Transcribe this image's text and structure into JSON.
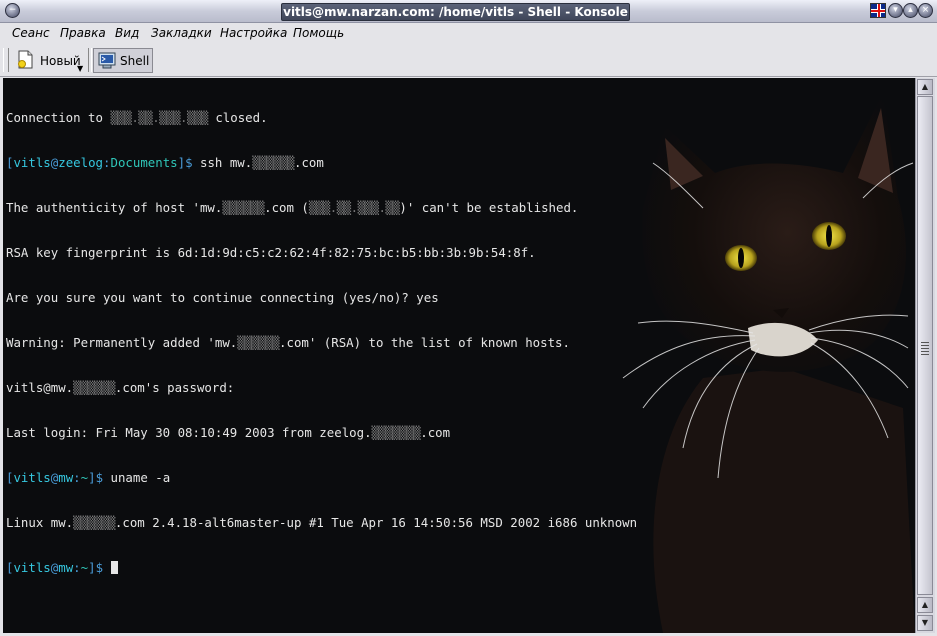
{
  "window": {
    "title": "vitls@mw.narzan.com: /home/vitls - Shell - Konsole"
  },
  "menubar": {
    "items": [
      "Сеанс",
      "Правка",
      "Вид",
      "Закладки",
      "Настройка",
      "Помощь"
    ]
  },
  "toolbar": {
    "new_label": "Новый",
    "shell_label": "Shell"
  },
  "terminal": {
    "lines": [
      {
        "t": "Connection to ",
        "b1": "▒▒▒.▒▒.▒▒▒.▒▒▒",
        "t2": " closed."
      },
      {
        "user": "vitls",
        "host": "zeelog",
        "path": "Documents",
        "cmd": " ssh mw.",
        "b1": "▒▒▒▒▒▒",
        "t2": ".com"
      },
      {
        "t": "The authenticity of host 'mw.",
        "b1": "▒▒▒▒▒▒",
        "t2": ".com (",
        "b2": "▒▒▒.▒▒.▒▒▒.▒▒",
        "t3": ")' can't be established."
      },
      {
        "t": "RSA key fingerprint is 6d:1d:9d:c5:c2:62:4f:82:75:bc:b5:bb:3b:9b:54:8f."
      },
      {
        "t": "Are you sure you want to continue connecting (yes/no)? yes"
      },
      {
        "t": "Warning: Permanently added 'mw.",
        "b1": "▒▒▒▒▒▒",
        "t2": ".com' (RSA) to the list of known hosts."
      },
      {
        "t": "vitls@mw.",
        "b1": "▒▒▒▒▒▒",
        "t2": ".com's password:"
      },
      {
        "t": "Last login: Fri May 30 08:10:49 2003 from zeelog.",
        "b1": "▒▒▒▒▒▒▒",
        "t2": ".com"
      },
      {
        "user": "vitls",
        "host": "mw",
        "path": "~",
        "cmd": " uname -a"
      },
      {
        "t": "Linux mw.",
        "b1": "▒▒▒▒▒▒",
        "t2": ".com 2.4.18-alt6master-up #1 Tue Apr 16 14:50:56 MSD 2002 i686 unknown"
      },
      {
        "user": "vitls",
        "host": "mw",
        "path": "~",
        "cmd": " "
      }
    ]
  },
  "colors": {
    "terminal_bg": "#0b0c0e",
    "prompt_bracket": "#4a9cd8",
    "prompt_user": "#36c8e0",
    "text": "#e6e6e6"
  },
  "icons": {
    "window_menu": "window-menu-icon",
    "flag": "uk-flag-icon",
    "new": "new-document-icon",
    "shell": "shell-terminal-icon"
  }
}
